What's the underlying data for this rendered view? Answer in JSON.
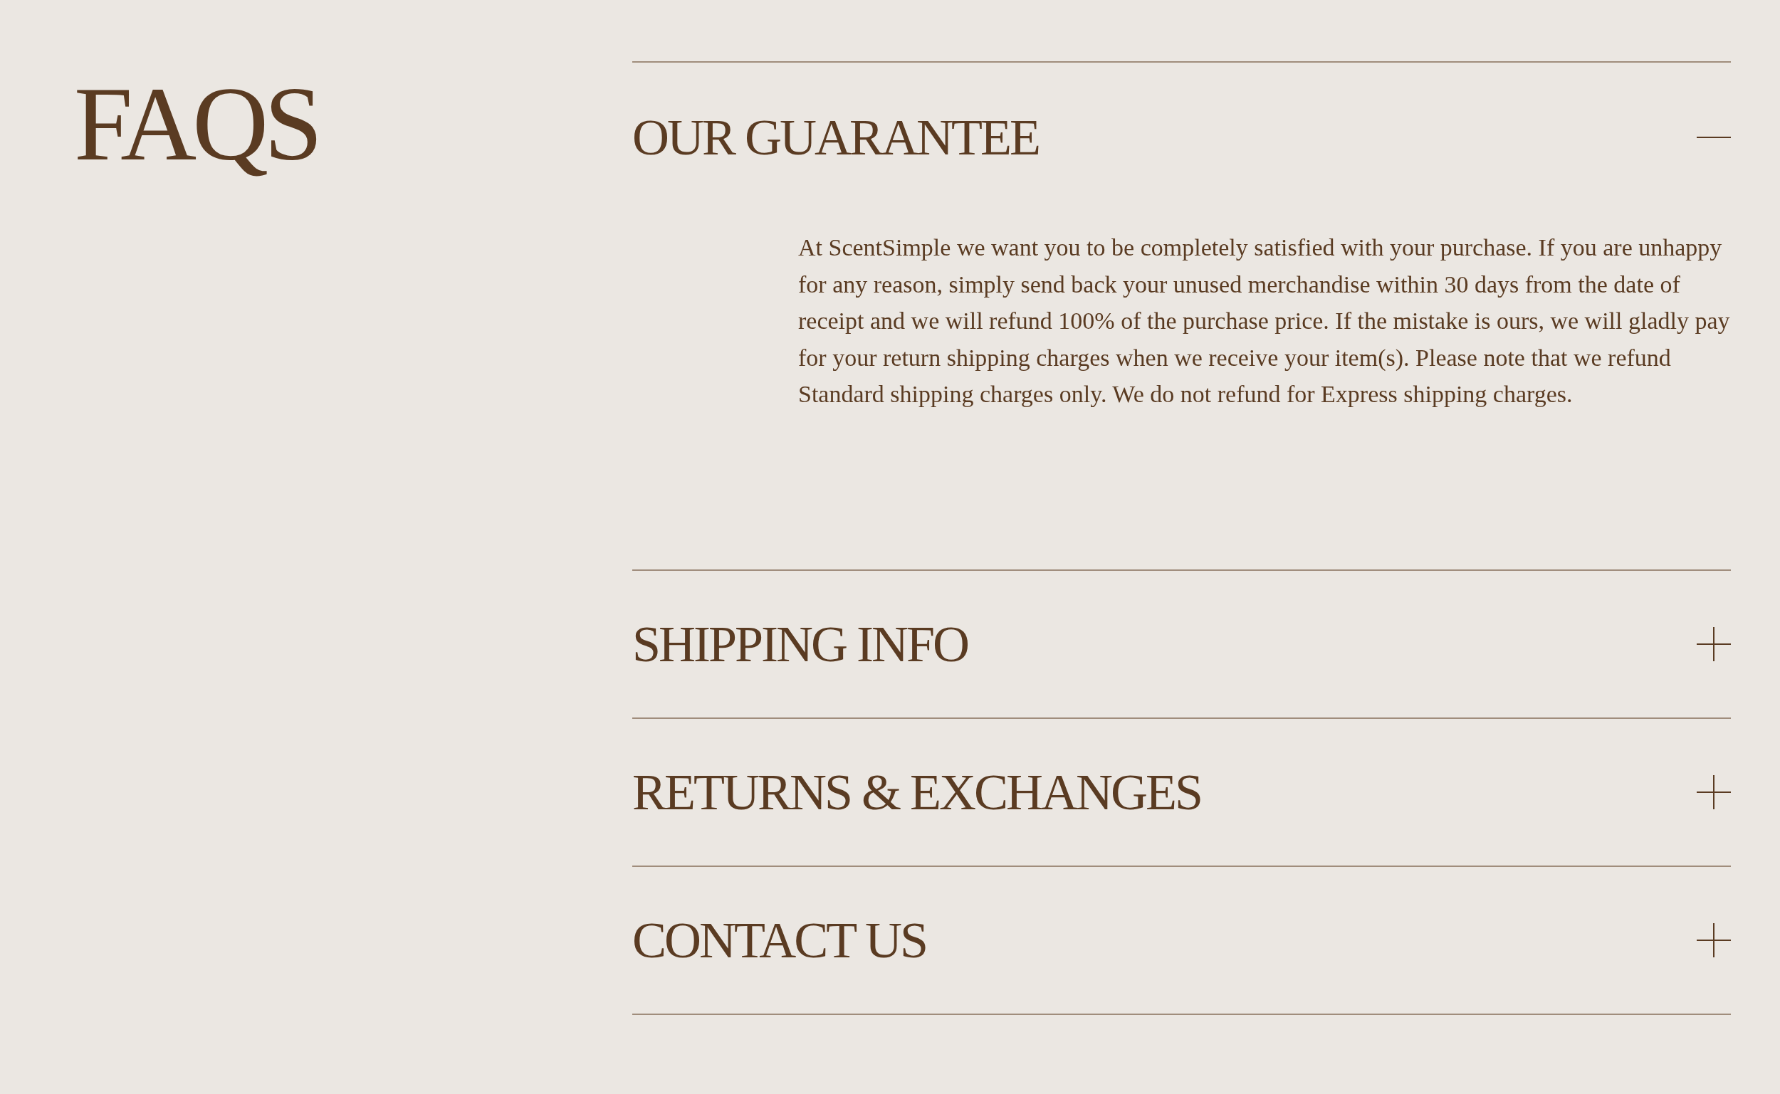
{
  "title": "FAQS",
  "items": [
    {
      "title": "OUR GUARANTEE",
      "expanded": true,
      "body": "At ScentSimple we want you to be completely satisfied with your purchase.  If you are unhappy for any reason, simply send back your unused merchandise within 30 days from the date of receipt and we will refund 100% of the purchase price.  If the mistake is ours, we will gladly pay for your return shipping charges when we receive your item(s).  Please note that we refund Standard shipping charges only. We do not refund for Express shipping charges."
    },
    {
      "title": "SHIPPING INFO",
      "expanded": false
    },
    {
      "title": "RETURNS & EXCHANGES",
      "expanded": false
    },
    {
      "title": "CONTACT US",
      "expanded": false
    }
  ]
}
